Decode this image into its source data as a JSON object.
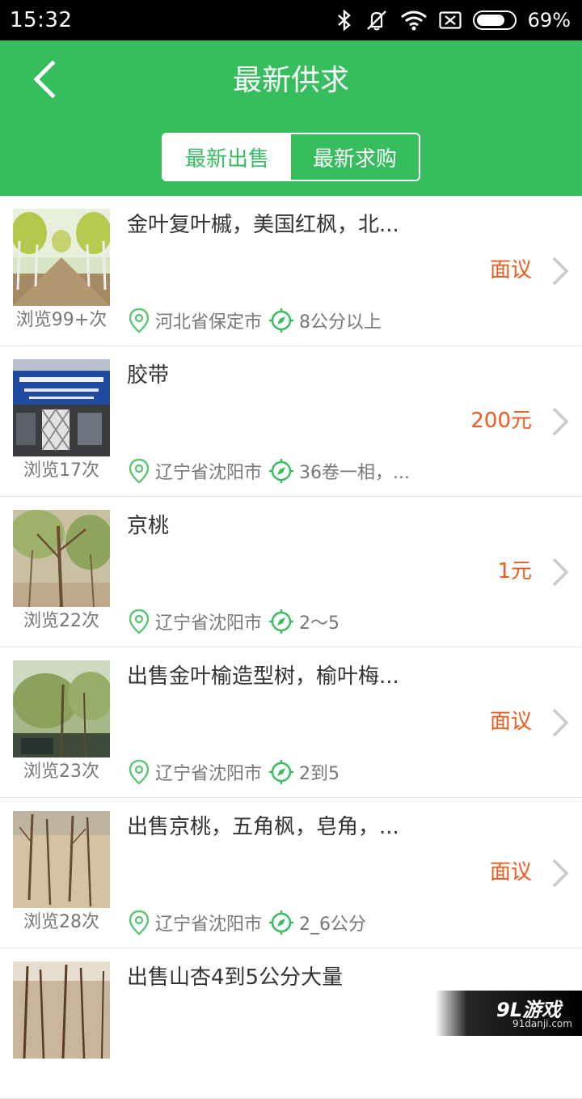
{
  "status_bar": {
    "time": "15:32",
    "battery": "69%",
    "icons": [
      "bluetooth-icon",
      "vibrate-off-icon",
      "wifi-icon",
      "sim-off-icon",
      "battery-icon"
    ]
  },
  "header": {
    "title": "最新供求",
    "back_icon": "back-arrow-icon",
    "background": "#35bd5e",
    "tabs": [
      {
        "label": "最新出售",
        "active": true
      },
      {
        "label": "最新求购",
        "active": false
      }
    ]
  },
  "list": {
    "price_color": "#f05a1e",
    "items": [
      {
        "name": "金叶复叶槭，美国红枫，北...",
        "price": "面议",
        "views": "浏览99+次",
        "location": "河北省保定市",
        "spec": "8公分以上"
      },
      {
        "name": "胶带",
        "price": "200元",
        "views": "浏览17次",
        "location": "辽宁省沈阳市",
        "spec": "36卷一相，..."
      },
      {
        "name": "京桃",
        "price": "1元",
        "views": "浏览22次",
        "location": "辽宁省沈阳市",
        "spec": "2～5"
      },
      {
        "name": "出售金叶榆造型树，榆叶梅...",
        "price": "面议",
        "views": "浏览23次",
        "location": "辽宁省沈阳市",
        "spec": "2到5"
      },
      {
        "name": "出售京桃，五角枫，皂角，...",
        "price": "面议",
        "views": "浏览28次",
        "location": "辽宁省沈阳市",
        "spec": "2_6公分"
      },
      {
        "name": "出售山杏4到5公分大量",
        "price": "",
        "views": "",
        "location": "",
        "spec": ""
      }
    ]
  },
  "watermark": {
    "logo": "9L游戏",
    "url": "91danji.com"
  }
}
